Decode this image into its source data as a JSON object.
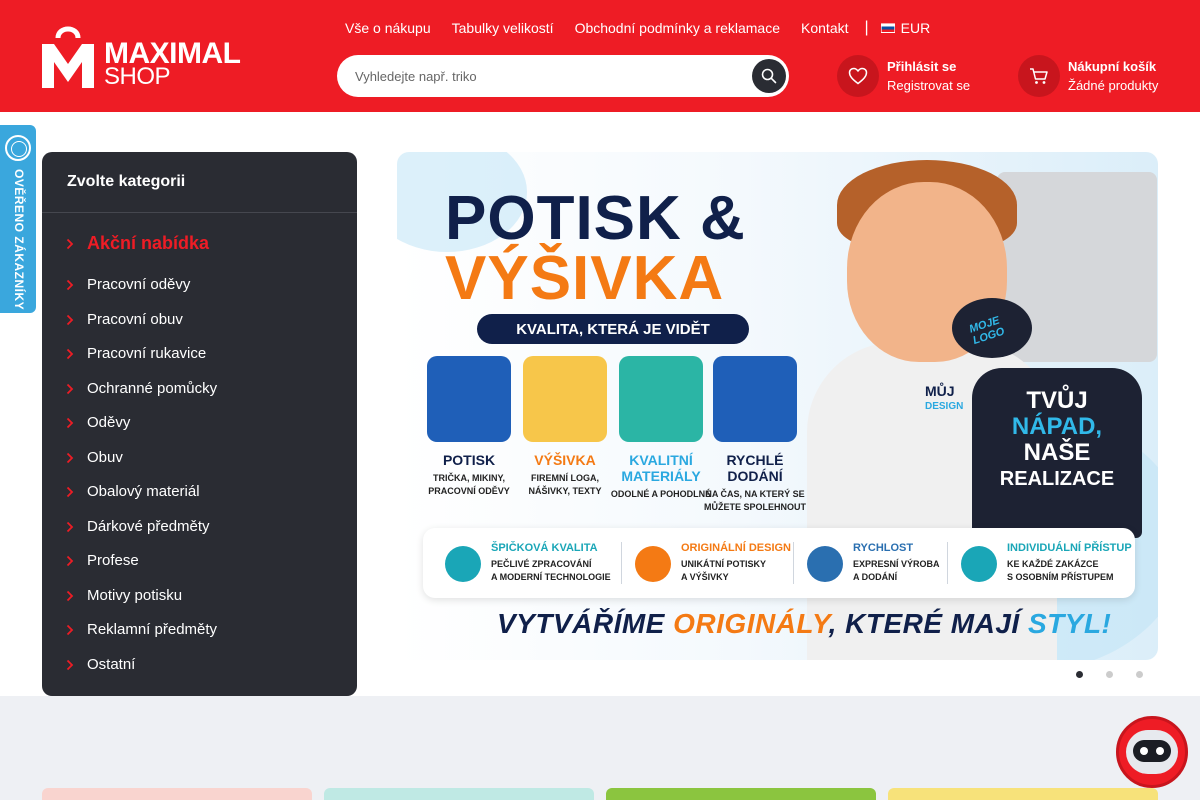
{
  "header": {
    "logo": {
      "line1": "MAXIMAL",
      "line2": "SHOP"
    },
    "nav": [
      "Vše o nákupu",
      "Tabulky velikostí",
      "Obchodní podmínky a reklamace",
      "Kontakt"
    ],
    "currency": "EUR",
    "search": {
      "placeholder": "Vyhledejte např. triko"
    },
    "account": {
      "line1": "Přihlásit se",
      "line2": "Registrovat se"
    },
    "cart": {
      "line1": "Nákupní košík",
      "line2": "Žádné produkty"
    }
  },
  "badge": {
    "text": "OVĚŘENO ZÁKAZNÍKY"
  },
  "categories": {
    "title": "Zvolte kategorii",
    "items": [
      "Akční nabídka",
      "Pracovní oděvy",
      "Pracovní obuv",
      "Pracovní rukavice",
      "Ochranné pomůcky",
      "Oděvy",
      "Obuv",
      "Obalový materiál",
      "Dárkové předměty",
      "Profese",
      "Motivy potisku",
      "Reklamní předměty",
      "Ostatní"
    ]
  },
  "banner": {
    "title1": "POTISK &",
    "title2": "VÝŠIVKA",
    "tagline": "KVALITA, KTERÁ JE VIDĚT",
    "tiles": [
      {
        "label": "POTISK",
        "sub": "TRIČKA, MIKINY, PRACOVNÍ ODĚVY",
        "color": "#10204a"
      },
      {
        "label": "VÝŠIVKA",
        "sub": "FIREMNÍ LOGA, NÁŠIVKY, TEXTY",
        "color": "#f47a14"
      },
      {
        "label": "KVALITNÍ MATERIÁLY",
        "sub": "ODOLNÉ A POHODLNÉ",
        "color": "#2aa8e0"
      },
      {
        "label": "RYCHLÉ DODÁNÍ",
        "sub": "NA ČAS, NA KTERÝ SE MŮŽETE SPOLEHNOUT",
        "color": "#10204a"
      }
    ],
    "features": [
      {
        "title": "ŠPIČKOVÁ KVALITA",
        "sub1": "PEČLIVÉ ZPRACOVÁNÍ",
        "sub2": "A MODERNÍ TECHNOLOGIE",
        "color": "#1aa6b7"
      },
      {
        "title": "ORIGINÁLNÍ DESIGN",
        "sub1": "UNIKÁTNÍ POTISKY",
        "sub2": "A VÝŠIVKY",
        "color": "#f47a14"
      },
      {
        "title": "RYCHLOST",
        "sub1": "EXPRESNÍ VÝROBA",
        "sub2": "A DODÁNÍ",
        "color": "#2a6fb0"
      },
      {
        "title": "INDIVIDUÁLNÍ PŘÍSTUP",
        "sub1": "KE KAŽDÉ ZAKÁZCE",
        "sub2": "S OSOBNÍM PŘÍSTUPEM",
        "color": "#1aa6b7"
      }
    ],
    "slogan": {
      "part1": "VYTVÁŘÍME ",
      "part2": "ORIGINÁLY",
      "part3": ", KTERÉ MAJÍ ",
      "part4": "STYL!"
    },
    "shirt_text": {
      "line1": "TVŮJ",
      "line2": "NÁPAD,",
      "line3": "NAŠE",
      "line4": "REALIZACE"
    },
    "small_shirt_text": "MOJE LOGO",
    "muj_design": {
      "line1": "MŮJ",
      "line2": "DESIGN"
    }
  },
  "slider": {
    "dots": 3,
    "active": 0
  },
  "colors": {
    "brand_red": "#ee1c25",
    "dark": "#2a2c33",
    "badge_blue": "#3aa7dd",
    "card_colors": [
      "#f9d4cf",
      "#bfe9e4",
      "#8bc53f",
      "#f7e27a"
    ]
  }
}
